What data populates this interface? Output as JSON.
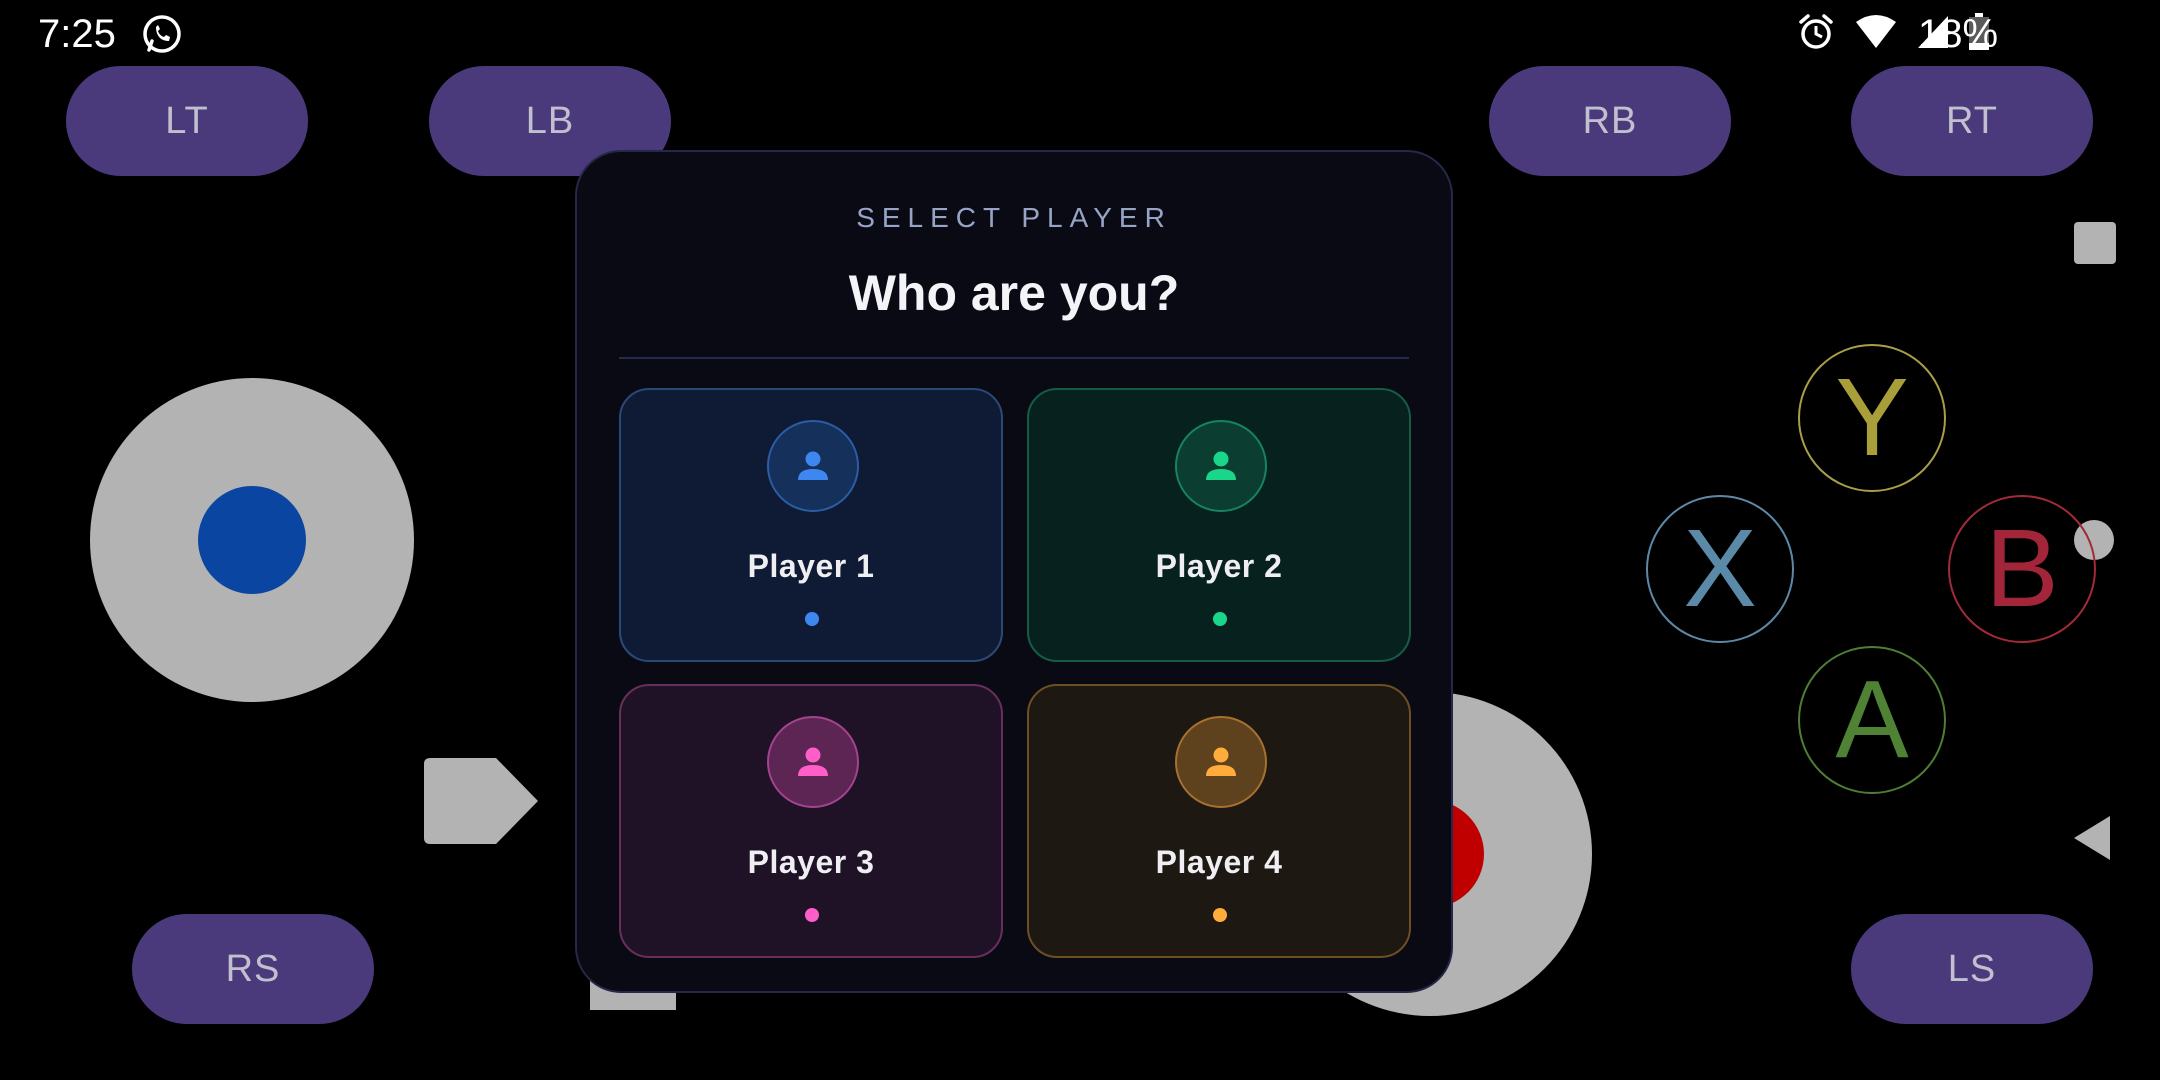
{
  "status_bar": {
    "time": "7:25",
    "notification_icon": "whatsapp-icon",
    "battery_percent": "18%",
    "icons": [
      "alarm-icon",
      "wifi-icon",
      "cell-signal-icon",
      "battery-icon"
    ]
  },
  "controller": {
    "shoulder": {
      "lt": "LT",
      "lb": "LB",
      "rb": "RB",
      "rt": "RT"
    },
    "sticks": {
      "rs": "RS",
      "ls": "LS"
    },
    "face_buttons": {
      "y": "Y",
      "x": "X",
      "b": "B",
      "a": "A"
    },
    "colors": {
      "pill": "#4a3a7c",
      "y": "#a89e3a",
      "x": "#5b8aa8",
      "b": "#a3253a",
      "a": "#4f8234",
      "left_stick_knob": "#0a45a2",
      "right_stick_knob": "#c00000"
    }
  },
  "modal": {
    "eyebrow": "SELECT PLAYER",
    "title": "Who are you?",
    "players": [
      {
        "label": "Player 1",
        "icon": "user-icon",
        "color": "#3f87f0"
      },
      {
        "label": "Player 2",
        "icon": "user-icon",
        "color": "#19d68a"
      },
      {
        "label": "Player 3",
        "icon": "user-icon",
        "color": "#ff5ec9"
      },
      {
        "label": "Player 4",
        "icon": "user-icon",
        "color": "#ffac3c"
      }
    ]
  }
}
